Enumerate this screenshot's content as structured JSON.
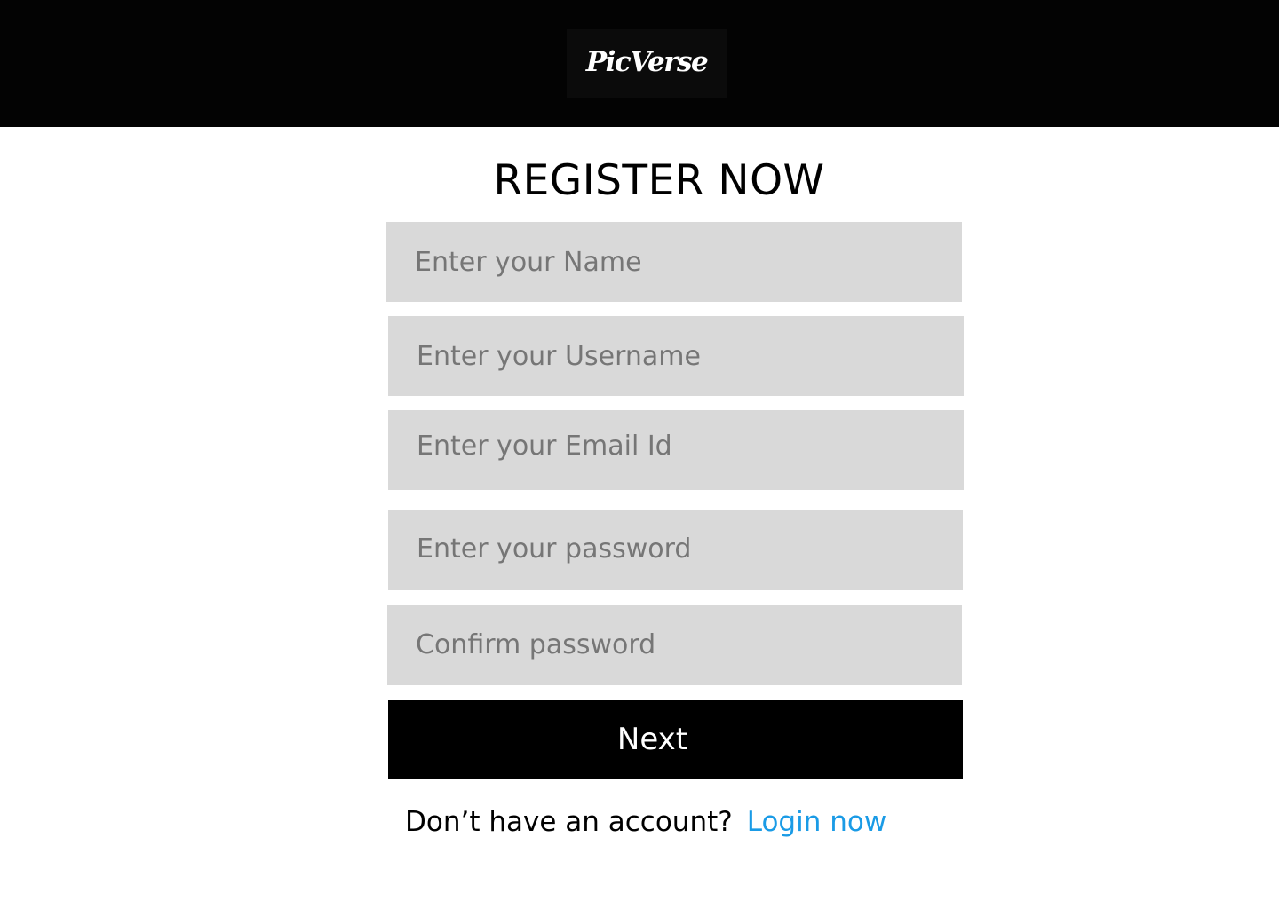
{
  "header": {
    "logo_text": "PicVerse"
  },
  "form": {
    "title": "REGISTER NOW",
    "fields": [
      {
        "placeholder": "Enter your Name",
        "value": ""
      },
      {
        "placeholder": "Enter your Username",
        "value": ""
      },
      {
        "placeholder": "Enter your Email Id",
        "value": ""
      },
      {
        "placeholder": "Enter your password",
        "value": ""
      },
      {
        "placeholder": "Confirm password",
        "value": ""
      }
    ],
    "submit_label": "Next",
    "account_prompt": "Don’t have an account?",
    "login_link_label": "Login now"
  },
  "colors": {
    "header_background": "#030303",
    "logo_background": "#0b0b0b",
    "field_background": "#d9d9d9",
    "placeholder_text": "#767676",
    "button_background": "#000000",
    "link": "#1a9be6"
  }
}
